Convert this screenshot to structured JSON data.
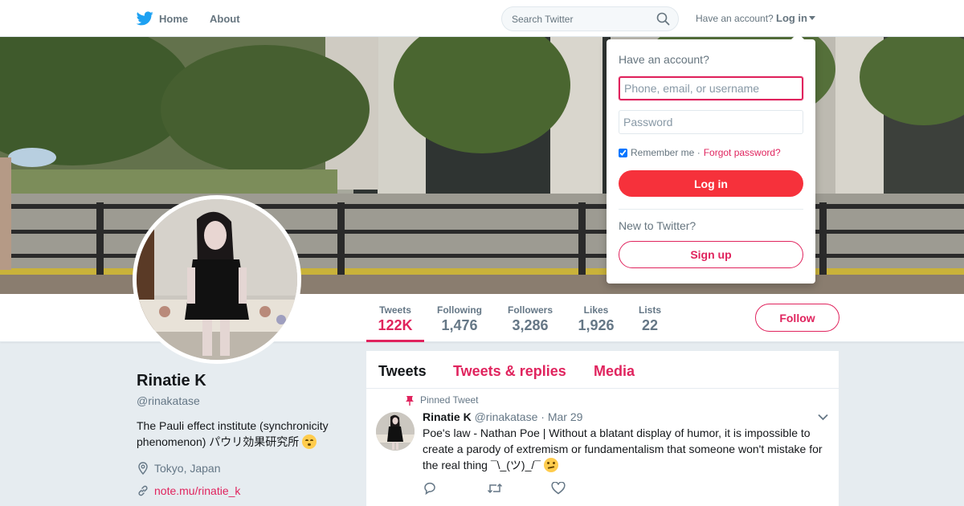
{
  "nav": {
    "home_label": "Home",
    "about_label": "About",
    "search_placeholder": "Search Twitter",
    "have_account": "Have an account?",
    "login_label": "Log in"
  },
  "profile": {
    "name": "Rinatie K",
    "handle": "@rinakatase",
    "bio": "The Pauli effect institute (synchronicity phenomenon) パウリ効果研究所",
    "bio_emoji": "kissing-face-emoji",
    "location": "Tokyo, Japan",
    "website": "note.mu/rinatie_k",
    "follow_label": "Follow"
  },
  "stats": [
    {
      "label": "Tweets",
      "value": "122K"
    },
    {
      "label": "Following",
      "value": "1,476"
    },
    {
      "label": "Followers",
      "value": "3,286"
    },
    {
      "label": "Likes",
      "value": "1,926"
    },
    {
      "label": "Lists",
      "value": "22"
    }
  ],
  "timeline": {
    "tabs": [
      "Tweets",
      "Tweets & replies",
      "Media"
    ],
    "pinned_label": "Pinned Tweet",
    "tweet": {
      "name": "Rinatie K",
      "handle": "@rinakatase",
      "date": "· Mar 29",
      "text": "Poe's law - Nathan Poe | Without a blatant display of humor, it is impossible to create a parody of extremism or fundamentalism that someone won't mistake for the real thing ¯\\_(ツ)_/¯",
      "emoji": "face-with-rolling-eyes-emoji"
    }
  },
  "login_dropdown": {
    "title": "Have an account?",
    "username_placeholder": "Phone, email, or username",
    "password_placeholder": "Password",
    "remember_label": "Remember me ·",
    "forgot_label": "Forgot password?",
    "login_button": "Log in",
    "new_to": "New to Twitter?",
    "signup_button": "Sign up"
  },
  "colors": {
    "accent": "#e0245e",
    "login_button": "#f6313b",
    "twitter_blue": "#1da1f2",
    "background": "#e6ecf0"
  }
}
